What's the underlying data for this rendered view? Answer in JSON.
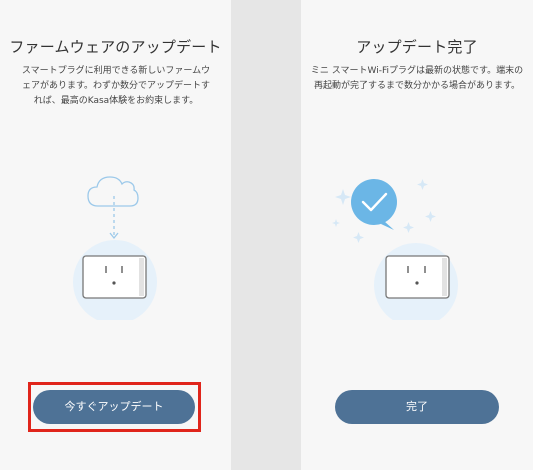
{
  "left": {
    "title": "ファームウェアのアップデート",
    "description": "スマートプラグに利用できる新しいファームウェアがあります。わずか数分でアップデートすれば、最高のKasa体験をお約束します。",
    "button_label": "今すぐアップデート"
  },
  "right": {
    "title": "アップデート完了",
    "description": "ミニ スマートWi-Fiプラグは最新の状態です。端末の再起動が完了するまで数分かかる場合があります。",
    "button_label": "完了"
  },
  "colors": {
    "button": "#4e7296",
    "highlight": "#e0251b",
    "check_bubble": "#6bb6e6",
    "cloud_stroke": "#9cc9ea"
  },
  "icons": [
    "cloud-download-icon",
    "smart-plug-icon",
    "checkmark-bubble-icon"
  ]
}
